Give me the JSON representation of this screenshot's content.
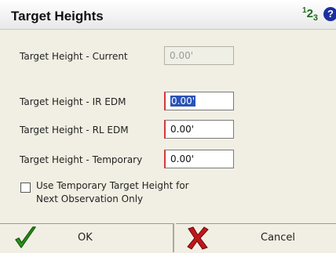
{
  "dialog": {
    "title": "Target Heights"
  },
  "fields": {
    "current": {
      "label": "Target Height - Current",
      "value": "0.00'"
    },
    "ir_edm": {
      "label": "Target Height - IR EDM",
      "value": "0.00'"
    },
    "rl_edm": {
      "label": "Target Height - RL EDM",
      "value": "0.00'"
    },
    "temporary": {
      "label": "Target Height - Temporary",
      "value": "0.00'"
    }
  },
  "checkbox": {
    "label_line1": "Use Temporary Target Height for",
    "label_line2": "Next Observation Only",
    "checked": false
  },
  "buttons": {
    "ok": "OK",
    "cancel": "Cancel"
  },
  "icons": {
    "number-pad": "123 green numeric icon",
    "help": "?"
  },
  "colors": {
    "background": "#f1efe3",
    "selection": "#2a52b8",
    "accent_red": "#d23a3a",
    "ok_green": "#2b9a1a",
    "cancel_red": "#c0161b"
  }
}
